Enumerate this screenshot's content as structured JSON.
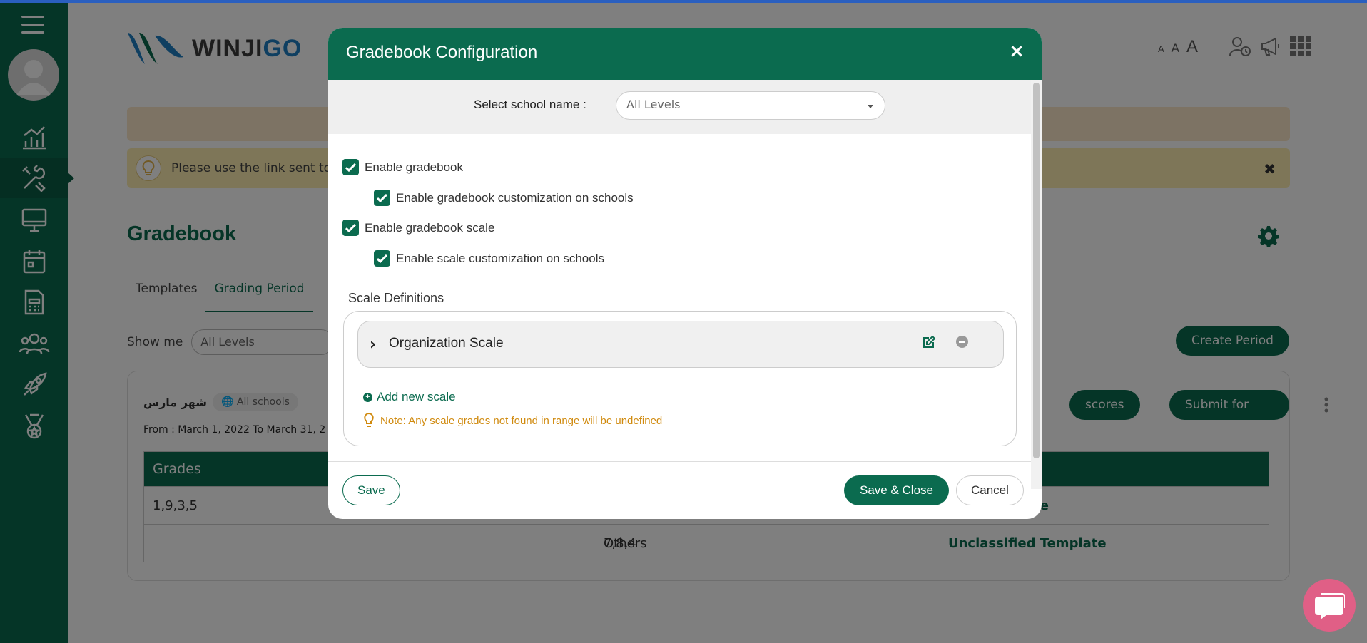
{
  "sidebar": {
    "items": [
      {
        "icon": "analytics-icon"
      },
      {
        "icon": "tools-icon",
        "active": true
      },
      {
        "icon": "monitor-icon"
      },
      {
        "icon": "calendar-icon"
      },
      {
        "icon": "calculator-report-icon"
      },
      {
        "icon": "users-group-icon"
      },
      {
        "icon": "rocket-icon"
      },
      {
        "icon": "medal-icon"
      }
    ]
  },
  "header": {
    "logo_text_main": "WINJI",
    "logo_text_accent": "GO",
    "font_size_labels": [
      "A",
      "A",
      "A"
    ]
  },
  "banner": {
    "message": "Please use the link sent to y"
  },
  "page": {
    "title": "Gradebook",
    "tabs": [
      "Templates",
      "Grading Period"
    ],
    "show_me_label": "Show me",
    "show_me_value": "All Levels",
    "create_button": "Create Period"
  },
  "card": {
    "name": "شهر مارس",
    "scope_chip": "All schools",
    "range": "From : March 1, 2022 To March 31, 2",
    "scores_button": "scores",
    "review_button": "Submit for review",
    "table": {
      "header": "Grades",
      "rows": [
        {
          "grades": "1,9,3,5",
          "category": "",
          "template": "emplate"
        },
        {
          "grades": "7,8,4",
          "category": "Others",
          "template": "Unclassified Template"
        }
      ]
    }
  },
  "modal": {
    "title": "Gradebook Configuration",
    "close_symbol": "×",
    "school_label": "Select school name :",
    "school_value": "All Levels",
    "checkboxes": [
      {
        "label": "Enable gradebook",
        "checked": true
      },
      {
        "label": "Enable gradebook customization on schools",
        "checked": true
      },
      {
        "label": "Enable gradebook scale",
        "checked": true
      },
      {
        "label": "Enable scale customization on schools",
        "checked": true
      }
    ],
    "scale_heading": "Scale Definitions",
    "scales": [
      {
        "name": "Organization Scale"
      }
    ],
    "add_scale_label": "Add new scale",
    "note": "Note: Any scale grades not found in range will be undefined",
    "buttons": {
      "save": "Save",
      "save_close": "Save & Close",
      "cancel": "Cancel"
    }
  },
  "colors": {
    "brand_green": "#0b6b4f",
    "note_orange": "#d08a0e",
    "chat_pink": "#e05f86"
  }
}
